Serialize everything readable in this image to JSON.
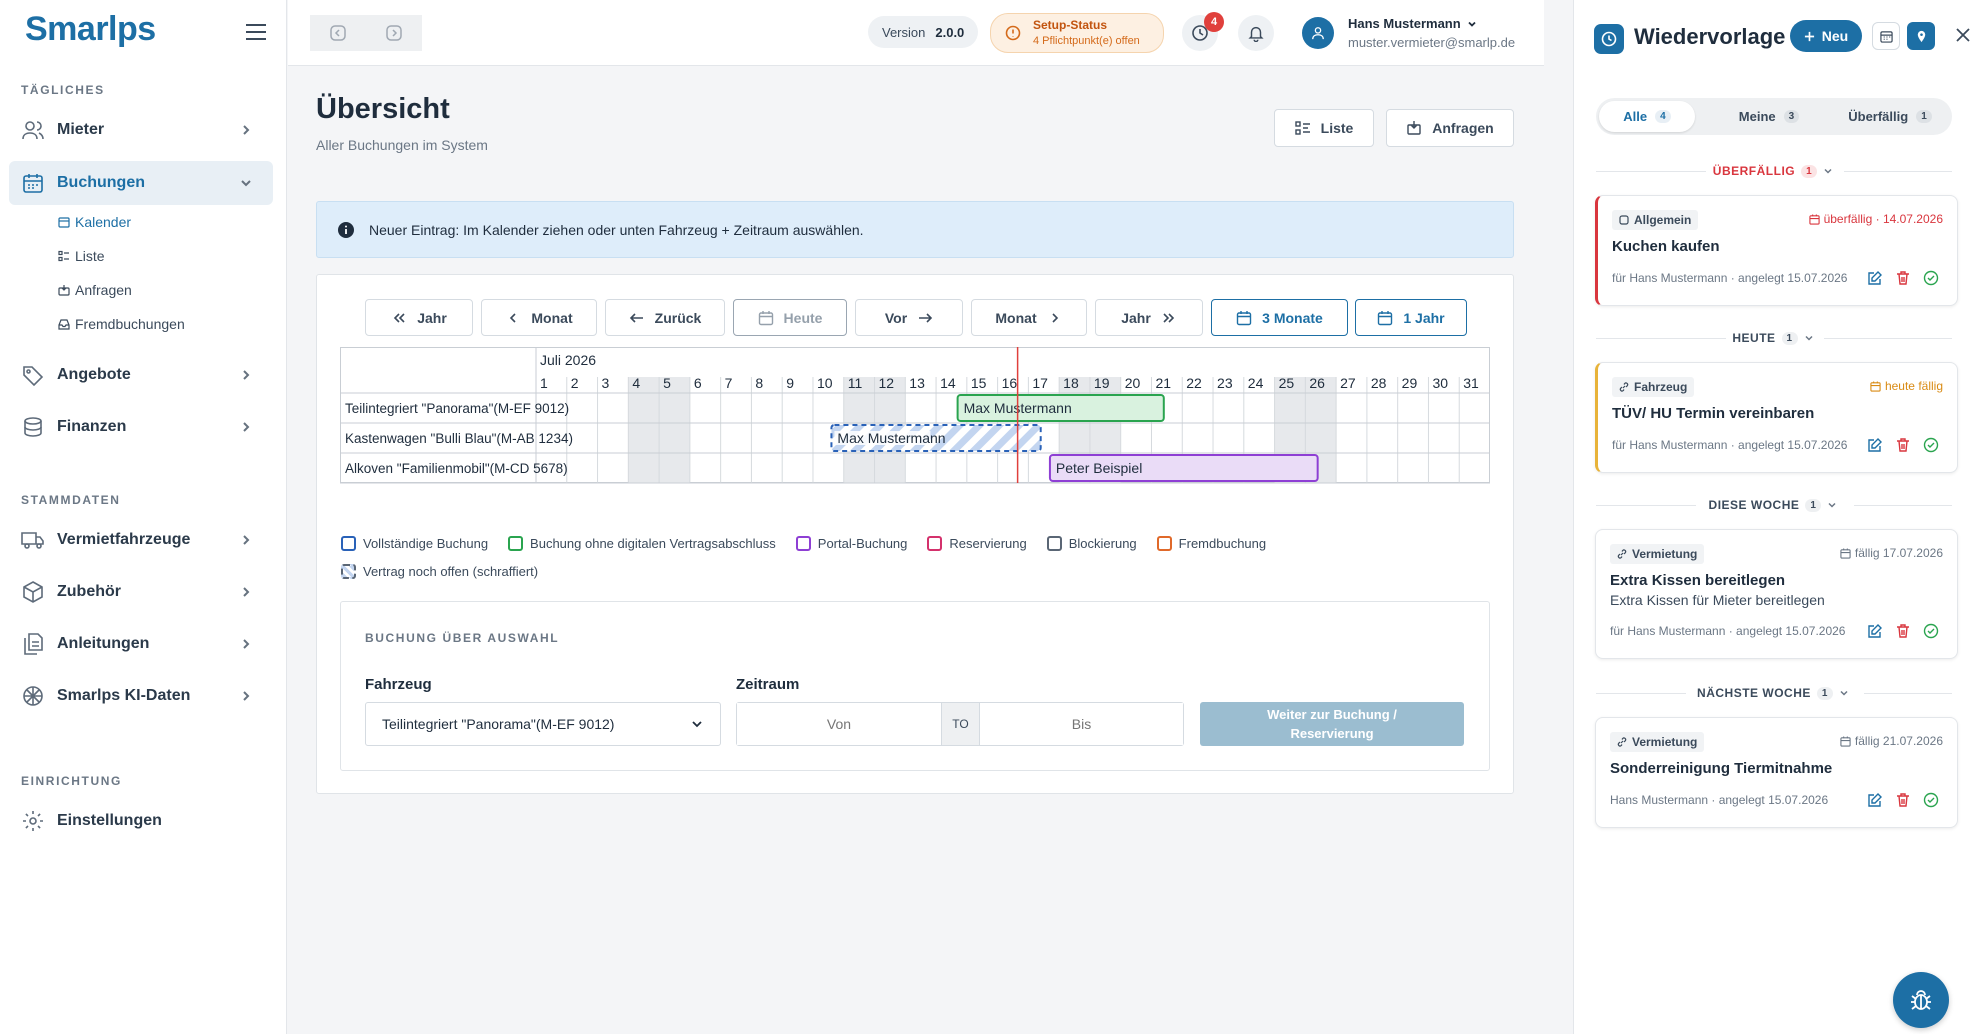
{
  "brand": {
    "logo": "Smarlps"
  },
  "sidebar": {
    "sections": {
      "daily": "TÄGLICHES",
      "master": "STAMMDATEN",
      "setup": "EINRICHTUNG"
    },
    "items": {
      "mieter": "Mieter",
      "buchungen": "Buchungen",
      "angebote": "Angebote",
      "finanzen": "Finanzen",
      "fahrzeuge": "Vermietfahrzeuge",
      "zubehoer": "Zubehör",
      "anleitungen": "Anleitungen",
      "ki": "Smarlps KI-Daten",
      "einstellungen": "Einstellungen"
    },
    "subitems": {
      "kalender": "Kalender",
      "liste": "Liste",
      "anfragen": "Anfragen",
      "fremd": "Fremdbuchungen"
    }
  },
  "topbar": {
    "version_label": "Version",
    "version_value": "2.0.0",
    "setup_title": "Setup-Status",
    "setup_sub": "4 Pflichtpunkt(e) offen",
    "timer_badge": "4",
    "user_name": "Hans Mustermann",
    "user_email": "muster.vermieter@smarlp.de"
  },
  "page": {
    "title": "Übersicht",
    "subtitle": "Aller Buchungen im System",
    "btn_list": "Liste",
    "btn_requests": "Anfragen"
  },
  "info": {
    "text": "Neuer Eintrag: Im Kalender ziehen oder unten Fahrzeug + Zeitraum auswählen."
  },
  "calnav": {
    "year_back": "Jahr",
    "month_back": "Monat",
    "back": "Zurück",
    "today": "Heute",
    "next": "Vor",
    "month_fwd": "Monat",
    "year_fwd": "Jahr",
    "three_months": "3 Monate",
    "one_year": "1 Jahr"
  },
  "calendar": {
    "month_label": "Juli 2026",
    "days": [
      "1",
      "2",
      "3",
      "4",
      "5",
      "6",
      "7",
      "8",
      "9",
      "10",
      "11",
      "12",
      "13",
      "14",
      "15",
      "16",
      "17",
      "18",
      "19",
      "20",
      "21",
      "22",
      "23",
      "24",
      "25",
      "26",
      "27",
      "28",
      "29",
      "30",
      "31"
    ],
    "weekends": [
      4,
      5,
      11,
      12,
      18,
      19,
      25,
      26
    ],
    "today_day": 16.65,
    "vehicles": [
      "Teilintegriert \"Panorama\"(M-EF 9012)",
      "Kastenwagen \"Bulli Blau\"(M-AB 1234)",
      "Alkoven \"Familienmobil\"(M-CD 5678)"
    ],
    "bookings": [
      {
        "row": 0,
        "start": 14.7,
        "end": 21.4,
        "label": "Max Mustermann",
        "kind": "ohne-digital",
        "color": "#2aa44f",
        "fill": "#d9f2df"
      },
      {
        "row": 1,
        "start": 10.6,
        "end": 17.4,
        "label": "Max Mustermann",
        "kind": "vertrag-offen",
        "color": "#2a62b8",
        "fill": "#dbe6f7"
      },
      {
        "row": 2,
        "start": 17.7,
        "end": 26.4,
        "label": "Peter Beispiel",
        "kind": "portal",
        "color": "#8e3fd4",
        "fill": "#eadcf7"
      }
    ]
  },
  "legend": [
    {
      "label": "Vollständige Buchung",
      "color": "#2a62b8"
    },
    {
      "label": "Buchung ohne digitalen Vertragsabschluss",
      "color": "#2aa44f"
    },
    {
      "label": "Portal-Buchung",
      "color": "#8e3fd4"
    },
    {
      "label": "Reservierung",
      "color": "#d4316c"
    },
    {
      "label": "Blockierung",
      "color": "#5a6675"
    },
    {
      "label": "Fremdbuchung",
      "color": "#e0692a"
    }
  ],
  "legend_hatched": "Vertrag noch offen (schraffiert)",
  "selection": {
    "heading": "BUCHUNG ÜBER AUSWAHL",
    "vehicle_label": "Fahrzeug",
    "vehicle_value": "Teilintegriert \"Panorama\"(M-EF 9012)",
    "period_label": "Zeitraum",
    "from_placeholder": "Von",
    "to_sep": "TO",
    "to_placeholder": "Bis",
    "submit_line1": "Weiter zur Buchung /",
    "submit_line2": "Reservierung"
  },
  "right": {
    "title": "Wiedervorlage",
    "new_btn": "Neu",
    "tabs": [
      {
        "label": "Alle",
        "count": "4"
      },
      {
        "label": "Meine",
        "count": "3"
      },
      {
        "label": "Überfällig",
        "count": "1"
      }
    ],
    "groups": {
      "overdue": "ÜBERFÄLLIG",
      "today": "HEUTE",
      "week": "DIESE WOCHE",
      "next": "NÄCHSTE WOCHE"
    },
    "group_counts": {
      "overdue": "1",
      "today": "1",
      "week": "1",
      "next": "1"
    },
    "cards": [
      {
        "tag": "Allgemein",
        "due": "überfällig · 14.07.2026",
        "title": "Kuchen kaufen",
        "sub": "",
        "meta": "für Hans Mustermann · angelegt 15.07.2026"
      },
      {
        "tag": "Fahrzeug",
        "due": "heute fällig",
        "title": "TÜV/ HU Termin vereinbaren",
        "sub": "",
        "meta": "für Hans Mustermann · angelegt 15.07.2026"
      },
      {
        "tag": "Vermietung",
        "due": "fällig 17.07.2026",
        "title": "Extra Kissen bereitlegen",
        "sub": "Extra Kissen für Mieter bereitlegen",
        "meta": "für Hans Mustermann · angelegt 15.07.2026"
      },
      {
        "tag": "Vermietung",
        "due": "fällig 21.07.2026",
        "title": "Sonderreinigung Tiermitnahme",
        "sub": "",
        "meta": "Hans Mustermann · angelegt 15.07.2026"
      }
    ]
  },
  "colors": {
    "primary": "#1d6fa5",
    "overdue": "#d9363e",
    "today": "#d98b14",
    "success": "#2aa44f"
  }
}
